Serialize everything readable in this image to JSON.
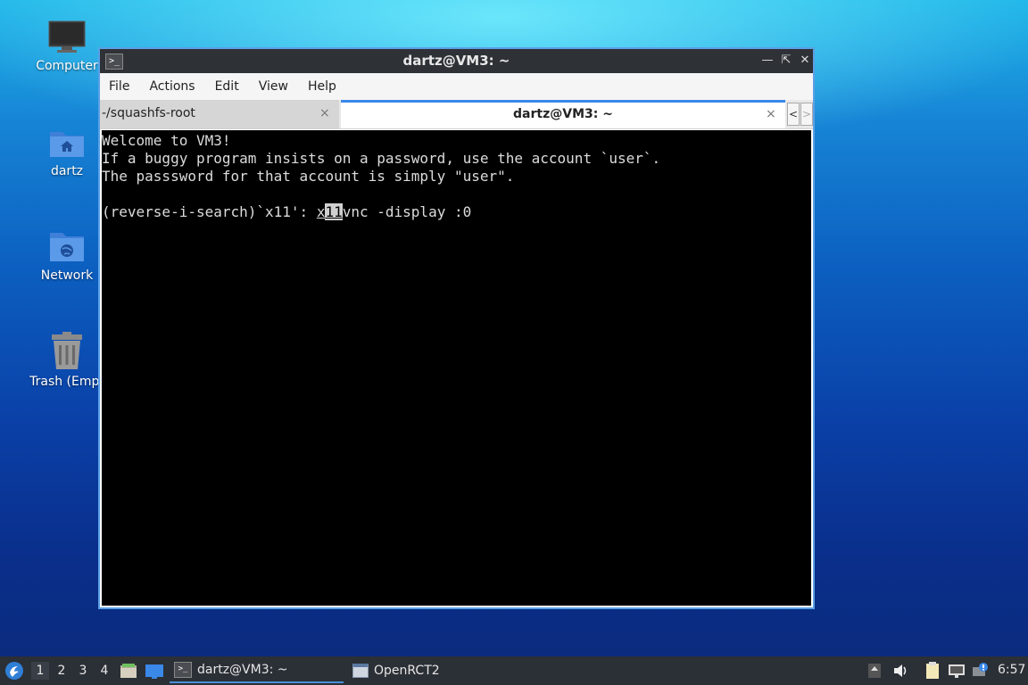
{
  "desktop": {
    "icons": [
      {
        "label": "Computer"
      },
      {
        "label": "dartz"
      },
      {
        "label": "Network"
      },
      {
        "label": "Trash (Empt"
      }
    ]
  },
  "window": {
    "title": "dartz@VM3: ~",
    "menu": [
      "File",
      "Actions",
      "Edit",
      "View",
      "Help"
    ],
    "tabs": [
      {
        "label": "-/squashfs-root",
        "active": false
      },
      {
        "label": "dartz@VM3: ~",
        "active": true
      }
    ],
    "tab_close_glyph": "×",
    "tab_scroll_left": "<",
    "tab_scroll_right": ">"
  },
  "terminal": {
    "lines": [
      "Welcome to VM3!",
      "If a buggy program insists on a password, use the account `user`.",
      "The passsword for that account is simply \"user\"."
    ],
    "search_prefix": "(reverse-i-search)`x11': ",
    "match_pre": "x",
    "match_hl": "11",
    "match_post": "vnc -display :0"
  },
  "taskbar": {
    "workspaces": [
      "1",
      "2",
      "3",
      "4"
    ],
    "active_workspace": "1",
    "tasks": [
      {
        "label": "dartz@VM3: ~",
        "icon": "terminal-icon",
        "active": true
      },
      {
        "label": "OpenRCT2",
        "icon": "window-icon",
        "active": false
      }
    ],
    "clock": "6:57"
  },
  "colors": {
    "accent": "#3a88e8",
    "taskbar_bg": "#2b2f36",
    "terminal_bg": "#000000",
    "terminal_fg": "#dcdcdc"
  }
}
